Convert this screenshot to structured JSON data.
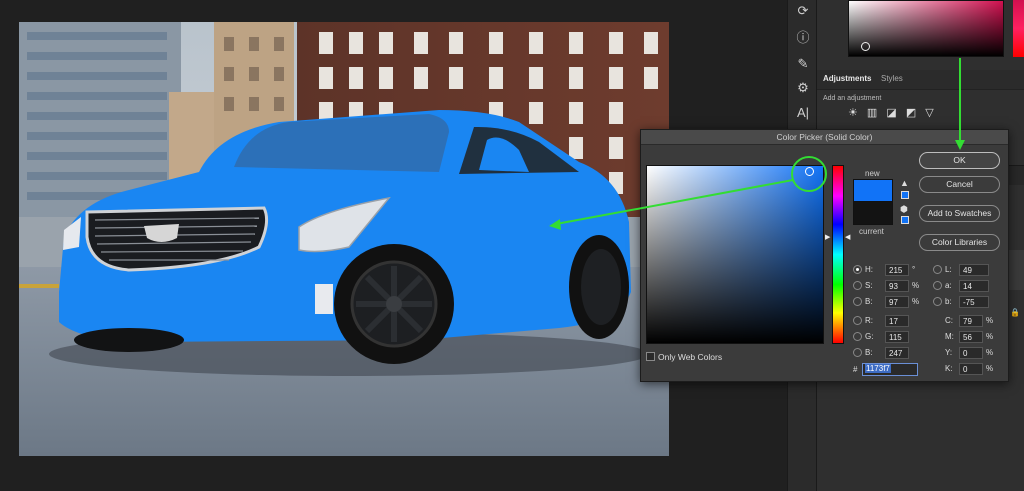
{
  "window": {
    "title": "Color Picker (Solid Color)"
  },
  "adjustments_panel": {
    "tabs": [
      "Adjustments",
      "Styles"
    ],
    "hint": "Add an adjustment",
    "icons_row": "☀ ▥ ◪ ◩ ▽"
  },
  "picker": {
    "new_label": "new",
    "current_label": "current",
    "new_color": "#1173f7",
    "current_color": "#131313",
    "buttons": {
      "ok": "OK",
      "cancel": "Cancel",
      "add_swatches": "Add to Swatches",
      "libraries": "Color Libraries"
    },
    "hsb": [
      {
        "label": "H:",
        "value": "215",
        "unit": "°",
        "selected": true
      },
      {
        "label": "S:",
        "value": "93",
        "unit": "%",
        "selected": false
      },
      {
        "label": "B:",
        "value": "97",
        "unit": "%",
        "selected": false
      }
    ],
    "rgb": [
      {
        "label": "R:",
        "value": "17"
      },
      {
        "label": "G:",
        "value": "115"
      },
      {
        "label": "B:",
        "value": "247"
      }
    ],
    "lab": [
      {
        "label": "L:",
        "value": "49"
      },
      {
        "label": "a:",
        "value": "14"
      },
      {
        "label": "b:",
        "value": "-75"
      }
    ],
    "cmyk": [
      {
        "label": "C:",
        "value": "79",
        "unit": "%"
      },
      {
        "label": "M:",
        "value": "56",
        "unit": "%"
      },
      {
        "label": "Y:",
        "value": "0",
        "unit": "%"
      },
      {
        "label": "K:",
        "value": "0",
        "unit": "%"
      }
    ],
    "only_web_colors": "Only Web Colors",
    "hex_hash": "#",
    "hex_value": "1173f7"
  },
  "colors": {
    "car": "#1a86f2",
    "annotation": "#33dd33"
  }
}
